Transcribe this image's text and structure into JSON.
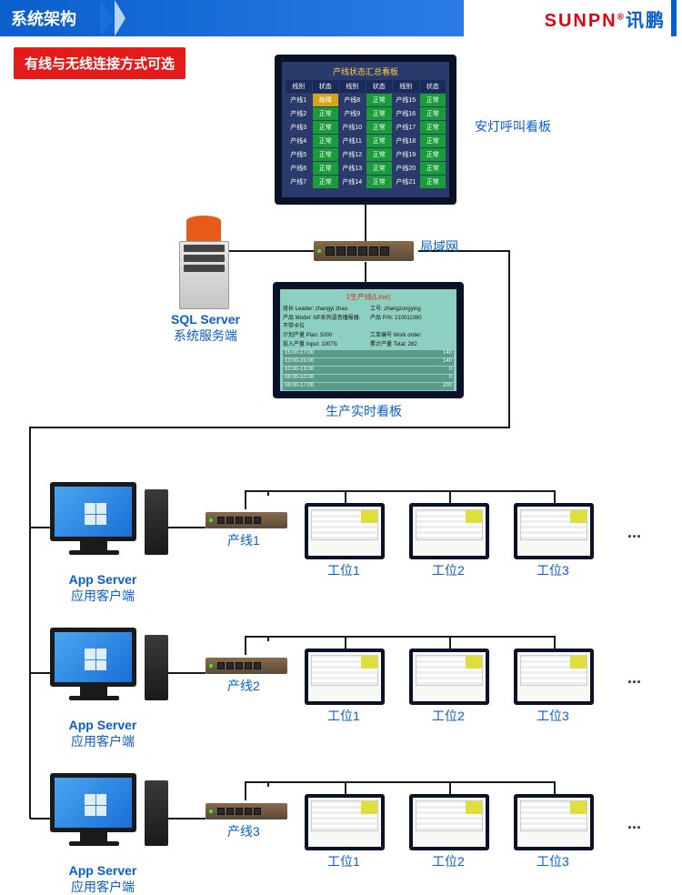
{
  "header": {
    "title": "系统架构",
    "brand_cn": "讯鹏",
    "brand_en": "SUNPN"
  },
  "badge": "有线与无线连接方式可选",
  "status_board": {
    "title": "产线状态汇总看板",
    "label": "安灯呼叫看板",
    "headers": [
      "线别",
      "状态",
      "线别",
      "状态",
      "线别",
      "状态"
    ],
    "rows": [
      [
        "产线1",
        "故障",
        "产线8",
        "正常",
        "产线15",
        "正常"
      ],
      [
        "产线2",
        "正常",
        "产线9",
        "正常",
        "产线16",
        "正常"
      ],
      [
        "产线3",
        "正常",
        "产线10",
        "正常",
        "产线17",
        "正常"
      ],
      [
        "产线4",
        "正常",
        "产线11",
        "正常",
        "产线18",
        "正常"
      ],
      [
        "产线5",
        "正常",
        "产线12",
        "正常",
        "产线19",
        "正常"
      ],
      [
        "产线6",
        "正常",
        "产线13",
        "正常",
        "产线20",
        "正常"
      ],
      [
        "产线7",
        "正常",
        "产线14",
        "正常",
        "产线21",
        "正常"
      ]
    ]
  },
  "server": {
    "l1": "SQL Server",
    "l2": "系统服务端"
  },
  "network_label": "局域网",
  "prod_board": {
    "title": "1生产线(Line)",
    "label": "生产实时看板",
    "info": [
      "班长 Leader: zhangyi zhao",
      "工号: zhangzongying",
      "产品 Model: NP系列语音播报器: 不带卡位",
      "产品 P/N: 210011080",
      "计划产量 Plan: 5000",
      "工单编号 Work order:",
      "投入产量 Input: 1007S",
      "累计产量 Total: 282"
    ]
  },
  "lines": [
    {
      "id": 1,
      "switch": "产线1",
      "client_l1": "App Server",
      "client_l2": "应用客户端",
      "ws": [
        "工位1",
        "工位2",
        "工位3"
      ]
    },
    {
      "id": 2,
      "switch": "产线2",
      "client_l1": "App Server",
      "client_l2": "应用客户端",
      "ws": [
        "工位1",
        "工位2",
        "工位3"
      ]
    },
    {
      "id": 3,
      "switch": "产线3",
      "client_l1": "App Server",
      "client_l2": "应用客户端",
      "ws": [
        "工位1",
        "工位2",
        "工位3"
      ]
    }
  ]
}
